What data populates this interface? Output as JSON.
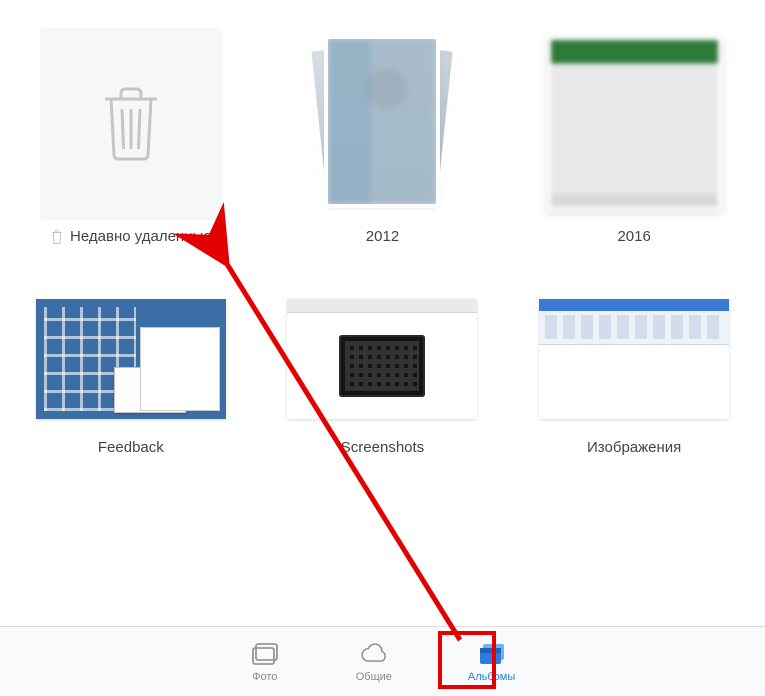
{
  "albums": [
    {
      "label": "Недавно удаленные",
      "has_trash_prefix": true
    },
    {
      "label": "2012"
    },
    {
      "label": "2016"
    },
    {
      "label": "Feedback"
    },
    {
      "label": "Screenshots"
    },
    {
      "label": "Изображения"
    }
  ],
  "toolbar": {
    "photos": "Фото",
    "shared": "Общие",
    "albums": "Альбомы",
    "active": "albums"
  },
  "annotation": {
    "arrow_color": "#e20000",
    "highlight_color": "#e20000"
  }
}
